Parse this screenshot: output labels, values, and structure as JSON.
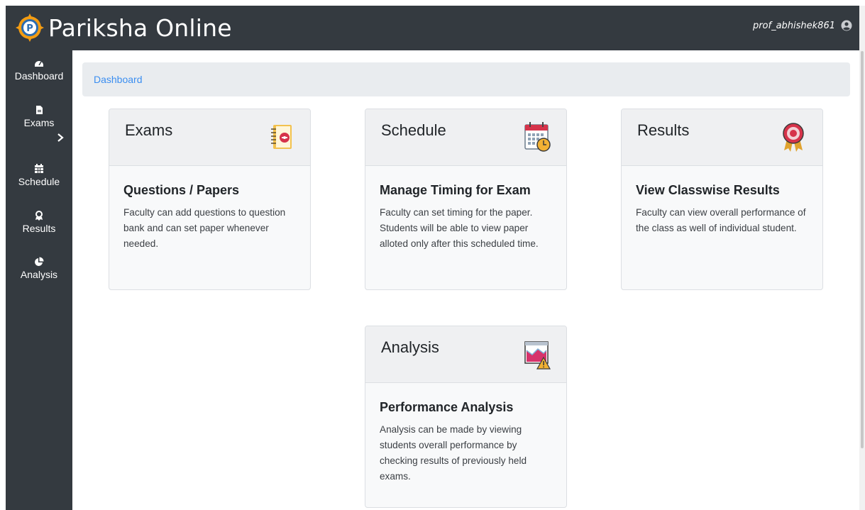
{
  "app": {
    "brand": "Pariksha Online",
    "username": "prof_abhishek861"
  },
  "sidebar": {
    "items": [
      {
        "label": "Dashboard",
        "icon": "dashboard-icon"
      },
      {
        "label": "Exams",
        "icon": "file-icon"
      },
      {
        "label": "Schedule",
        "icon": "calendar-icon"
      },
      {
        "label": "Results",
        "icon": "award-icon"
      },
      {
        "label": "Analysis",
        "icon": "pie-chart-icon"
      }
    ]
  },
  "breadcrumb": {
    "current": "Dashboard"
  },
  "cards": [
    {
      "title": "Exams",
      "subtitle": "Questions / Papers",
      "text": "Faculty can add questions to question bank and can set paper whenever needed.",
      "icon": "notebook-icon"
    },
    {
      "title": "Schedule",
      "subtitle": "Manage Timing for Exam",
      "text": "Faculty can set timing for the paper. Students will be able to view paper alloted only after this scheduled time.",
      "icon": "calendar-clock-icon"
    },
    {
      "title": "Results",
      "subtitle": "View Classwise Results",
      "text": "Faculty can view overall performance of the class as well of individual student.",
      "icon": "award-ribbon-icon"
    },
    {
      "title": "Analysis",
      "subtitle": "Performance Analysis",
      "text": "Analysis can be made by viewing students overall performance by checking results of previously held exams.",
      "icon": "chart-warning-icon"
    }
  ],
  "colors": {
    "navbar_bg": "#343a40",
    "breadcrumb_bg": "#e9ecef",
    "link": "#3b8ef0",
    "card_bg": "#f8f9fa"
  }
}
